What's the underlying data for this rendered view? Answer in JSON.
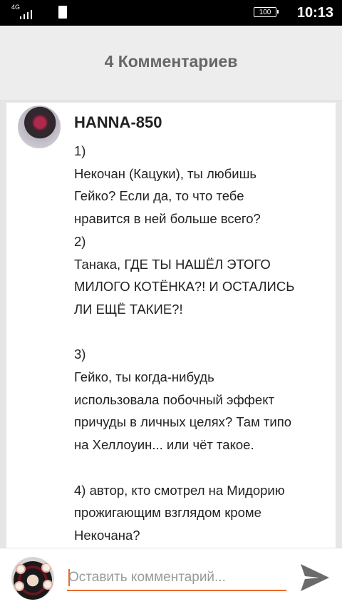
{
  "status_bar": {
    "network": "4G",
    "battery": "100",
    "time": "10:13"
  },
  "header": {
    "title": "4 Комментариев"
  },
  "comments": [
    {
      "author": "HANNA-850",
      "text": "1)\nНекочан (Кацуки), ты любишь\nГейко? Если да, то что тебе\nнравится в ней больше всего?\n2)\nТанака, ГДЕ ТЫ НАШЁЛ ЭТОГО\nМИЛОГО КОТЁНКА?! И ОСТАЛИСЬ\nЛИ ЕЩЁ ТАКИЕ?!\n\n3)\nГейко, ты когда-нибудь\nиспользовала побочный эффект\nпричуды в личных целях? Там типо\nна Хеллоуин... или чёт такое.\n\n4) автор, кто смотрел на Мидорию\nпрожигающим взглядом кроме\nНекочана?"
    }
  ],
  "comment_input": {
    "placeholder": "Оставить комментарий..."
  },
  "colors": {
    "accent": "#ec6a2c",
    "header_text": "#666666"
  },
  "icons": {
    "send": "send-icon",
    "signal": "signal-icon",
    "sim": "sim-icon",
    "battery": "battery-icon"
  }
}
